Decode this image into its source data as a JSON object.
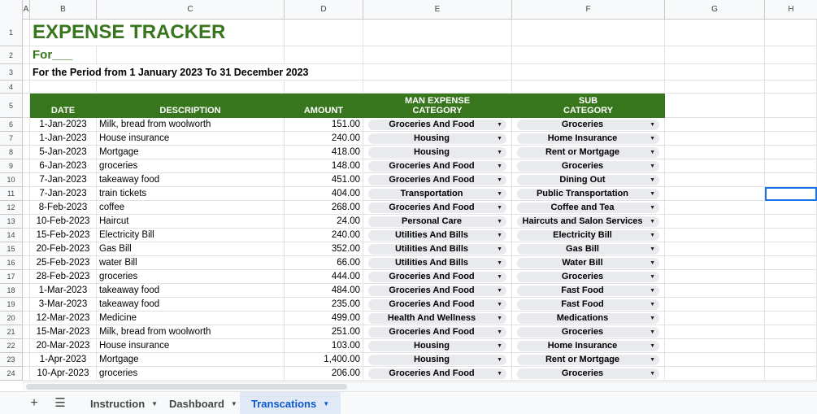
{
  "columns": [
    "A",
    "B",
    "C",
    "D",
    "E",
    "F",
    "G",
    "H"
  ],
  "title": "EXPENSE TRACKER",
  "for_label": "For___",
  "period": "For the Period from 1 January 2023 To 31 December 2023",
  "headers": {
    "date": "DATE",
    "description": "DESCRIPTION",
    "amount": "AMOUNT",
    "main_cat_line1": "MAN EXPENSE",
    "main_cat_line2": "CATEGORY",
    "sub_cat_line1": "SUB",
    "sub_cat_line2": "CATEGORY"
  },
  "row_numbers": [
    "1",
    "2",
    "3",
    "4",
    "5"
  ],
  "rows": [
    {
      "num": "6",
      "date": "1-Jan-2023",
      "desc": "Milk, bread from woolworth",
      "amount": "151.00",
      "cat": "Groceries And Food",
      "sub": "Groceries"
    },
    {
      "num": "7",
      "date": "1-Jan-2023",
      "desc": "House insurance",
      "amount": "240.00",
      "cat": "Housing",
      "sub": "Home Insurance"
    },
    {
      "num": "8",
      "date": "5-Jan-2023",
      "desc": "Mortgage",
      "amount": "418.00",
      "cat": "Housing",
      "sub": "Rent or Mortgage"
    },
    {
      "num": "9",
      "date": "6-Jan-2023",
      "desc": "groceries",
      "amount": "148.00",
      "cat": "Groceries And Food",
      "sub": "Groceries"
    },
    {
      "num": "10",
      "date": "7-Jan-2023",
      "desc": "takeaway food",
      "amount": "451.00",
      "cat": "Groceries And Food",
      "sub": "Dining Out"
    },
    {
      "num": "11",
      "date": "7-Jan-2023",
      "desc": "train tickets",
      "amount": "404.00",
      "cat": "Transportation",
      "sub": "Public Transportation"
    },
    {
      "num": "12",
      "date": "8-Feb-2023",
      "desc": "coffee",
      "amount": "268.00",
      "cat": "Groceries And Food",
      "sub": "Coffee and Tea"
    },
    {
      "num": "13",
      "date": "10-Feb-2023",
      "desc": "Haircut",
      "amount": "24.00",
      "cat": "Personal Care",
      "sub": "Haircuts and Salon Services"
    },
    {
      "num": "14",
      "date": "15-Feb-2023",
      "desc": "Electricity Bill",
      "amount": "240.00",
      "cat": "Utilities And Bills",
      "sub": "Electricity Bill"
    },
    {
      "num": "15",
      "date": "20-Feb-2023",
      "desc": "Gas Bill",
      "amount": "352.00",
      "cat": "Utilities And Bills",
      "sub": "Gas Bill"
    },
    {
      "num": "16",
      "date": "25-Feb-2023",
      "desc": "water Bill",
      "amount": "66.00",
      "cat": "Utilities And Bills",
      "sub": "Water Bill"
    },
    {
      "num": "17",
      "date": "28-Feb-2023",
      "desc": "groceries",
      "amount": "444.00",
      "cat": "Groceries And Food",
      "sub": "Groceries"
    },
    {
      "num": "18",
      "date": "1-Mar-2023",
      "desc": "takeaway food",
      "amount": "484.00",
      "cat": "Groceries And Food",
      "sub": "Fast Food"
    },
    {
      "num": "19",
      "date": "3-Mar-2023",
      "desc": "takeaway food",
      "amount": "235.00",
      "cat": "Groceries And Food",
      "sub": "Fast Food"
    },
    {
      "num": "20",
      "date": "12-Mar-2023",
      "desc": "Medicine",
      "amount": "499.00",
      "cat": "Health And Wellness",
      "sub": "Medications"
    },
    {
      "num": "21",
      "date": "15-Mar-2023",
      "desc": "Milk, bread from woolworth",
      "amount": "251.00",
      "cat": "Groceries And Food",
      "sub": "Groceries"
    },
    {
      "num": "22",
      "date": "20-Mar-2023",
      "desc": "House insurance",
      "amount": "103.00",
      "cat": "Housing",
      "sub": "Home Insurance"
    },
    {
      "num": "23",
      "date": "1-Apr-2023",
      "desc": "Mortgage",
      "amount": "1,400.00",
      "cat": "Housing",
      "sub": "Rent or Mortgage"
    },
    {
      "num": "24",
      "date": "10-Apr-2023",
      "desc": "groceries",
      "amount": "206.00",
      "cat": "Groceries And Food",
      "sub": "Groceries"
    }
  ],
  "icons": {
    "add": "plus-icon",
    "menu": "hamburger-icon",
    "caret": "caret-down-icon"
  },
  "tabs": [
    {
      "label": "Instruction",
      "active": false
    },
    {
      "label": "Dashboard",
      "active": false
    },
    {
      "label": "Transcations",
      "active": true
    }
  ],
  "colors": {
    "header_green": "#38761d",
    "active_tab": "#0b57d0",
    "selection": "#1a73e8"
  }
}
